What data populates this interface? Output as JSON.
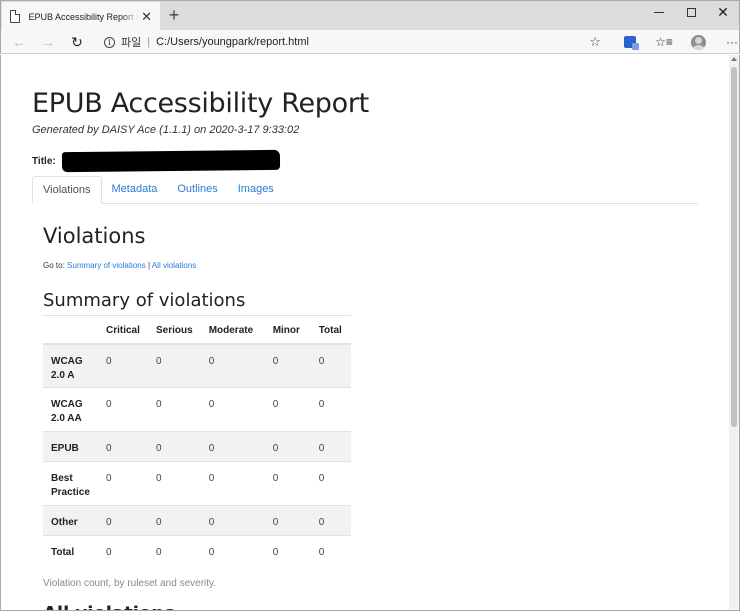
{
  "browser": {
    "tab_title": "EPUB Accessibility Report by DAISY Ace",
    "new_tab_symbol": "+",
    "address_label": "파일",
    "address_url": "C:/Users/youngpark/report.html",
    "icons": [
      "document-icon",
      "close-icon",
      "plus-icon",
      "minimize-icon",
      "maximize-icon",
      "window-close-icon",
      "back-icon",
      "forward-icon",
      "refresh-icon",
      "info-icon",
      "star-icon",
      "translate-icon",
      "favorites-icon",
      "avatar-icon",
      "more-icon"
    ]
  },
  "report": {
    "title": "EPUB Accessibility Report",
    "generated": "Generated by DAISY Ace (1.1.1) on 2020-3-17 9:33:02",
    "title_label": "Title:",
    "tabs": [
      {
        "label": "Violations",
        "active": true
      },
      {
        "label": "Metadata",
        "active": false
      },
      {
        "label": "Outlines",
        "active": false
      },
      {
        "label": "Images",
        "active": false
      }
    ],
    "violations_heading": "Violations",
    "goto_prefix": "Go to:",
    "goto_summary": "Summary of violations",
    "goto_sep": "|",
    "goto_all": "All violations",
    "summary_heading": "Summary of violations",
    "table": {
      "headers": [
        "",
        "Critical",
        "Serious",
        "Moderate",
        "Minor",
        "Total"
      ],
      "rows": [
        {
          "label": "WCAG 2.0 A",
          "values": [
            "0",
            "0",
            "0",
            "0",
            "0"
          ]
        },
        {
          "label": "WCAG 2.0 AA",
          "values": [
            "0",
            "0",
            "0",
            "0",
            "0"
          ]
        },
        {
          "label": "EPUB",
          "values": [
            "0",
            "0",
            "0",
            "0",
            "0"
          ]
        },
        {
          "label": "Best Practice",
          "values": [
            "0",
            "0",
            "0",
            "0",
            "0"
          ]
        },
        {
          "label": "Other",
          "values": [
            "0",
            "0",
            "0",
            "0",
            "0"
          ]
        },
        {
          "label": "Total",
          "values": [
            "0",
            "0",
            "0",
            "0",
            "0"
          ]
        }
      ]
    },
    "caption": "Violation count, by ruleset and severity.",
    "all_heading": "All violations"
  },
  "colors": {
    "link": "#2a7bd5",
    "stripe": "#f2f2f2",
    "border": "#dee2e6"
  }
}
